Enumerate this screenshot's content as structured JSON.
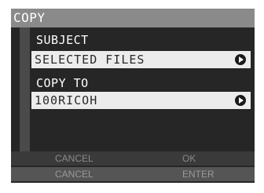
{
  "title": "COPY",
  "subject": {
    "label": "SUBJECT",
    "value": "SELECTED FILES",
    "icon": "arrow-right-icon"
  },
  "copy_to": {
    "label": "COPY TO",
    "value": "100RICOH",
    "icon": "arrow-right-icon"
  },
  "footer": {
    "top_left": "CANCEL",
    "top_right": "OK",
    "bottom_left": "CANCEL",
    "bottom_right": "ENTER"
  }
}
